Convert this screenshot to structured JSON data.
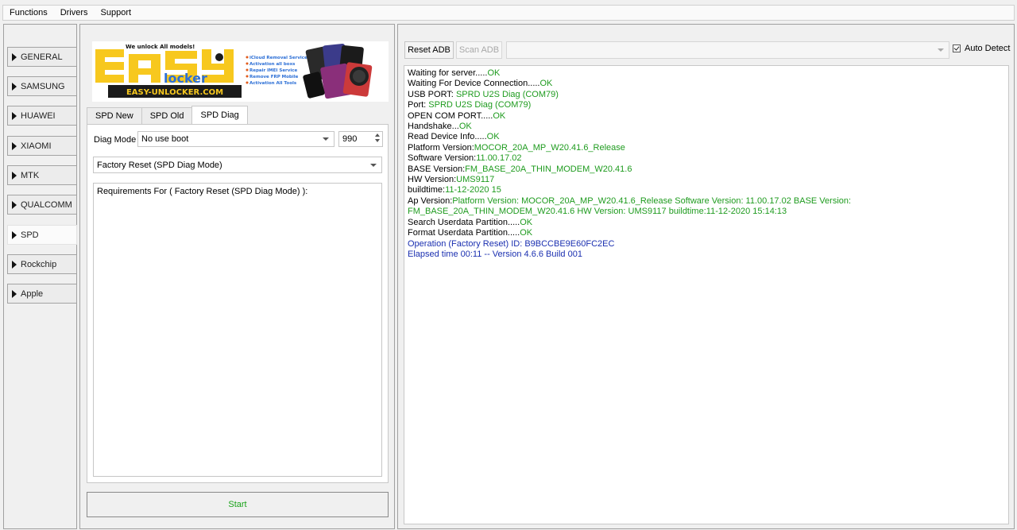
{
  "menu": [
    "Functions",
    "Drivers",
    "Support"
  ],
  "brands": [
    {
      "label": "GENERAL",
      "active": false
    },
    {
      "label": "SAMSUNG",
      "active": false
    },
    {
      "label": "HUAWEI",
      "active": false
    },
    {
      "label": "XIAOMI",
      "active": false
    },
    {
      "label": "MTK",
      "active": false
    },
    {
      "label": "QUALCOMM",
      "active": false
    },
    {
      "label": "SPD",
      "active": true
    },
    {
      "label": "Rockchip",
      "active": false
    },
    {
      "label": "Apple",
      "active": false
    }
  ],
  "banner": {
    "slogan": "We unlock All models!",
    "logo_text_1": "EASY",
    "logo_text_2": "locker",
    "website": "EASY-UNLOCKER.COM",
    "features": [
      "iCloud Removal Service",
      "Activation all boxs",
      "Repair IMEI Service",
      "Remove FRP Mobile",
      "Activation All Tools"
    ],
    "colors": {
      "yellow": "#f7c81e",
      "blue": "#2c6fd6",
      "dark": "#1b1b1b"
    }
  },
  "tabs": [
    {
      "label": "SPD New",
      "active": false
    },
    {
      "label": "SPD Old",
      "active": false
    },
    {
      "label": "SPD Diag",
      "active": true
    }
  ],
  "diag": {
    "label": "Diag Mode",
    "mode_value": "No use boot",
    "spin_value": "990",
    "operation_value": "Factory Reset (SPD Diag Mode)",
    "requirements_text": "Requirements For ( Factory Reset (SPD Diag Mode) ):"
  },
  "start_label": "Start",
  "right": {
    "reset_adb": "Reset ADB",
    "scan_adb": "Scan ADB",
    "device_value": "",
    "auto_detect": "Auto Detect",
    "auto_detect_checked": true
  },
  "log": [
    {
      "k": "Waiting for server.....",
      "v": "OK",
      "c": "ok"
    },
    {
      "k": "Waiting For Device Connection.....",
      "v": "OK",
      "c": "ok"
    },
    {
      "k": "USB PORT: ",
      "v": "SPRD U2S Diag (COM79)",
      "c": "ok"
    },
    {
      "k": "Port: ",
      "v": "SPRD U2S Diag (COM79)",
      "c": "ok"
    },
    {
      "k": "OPEN COM PORT.....",
      "v": "OK",
      "c": "ok"
    },
    {
      "k": "Handshake...",
      "v": "OK",
      "c": "ok"
    },
    {
      "k": "Read Device Info.....",
      "v": "OK",
      "c": "ok"
    },
    {
      "k": "Platform Version:",
      "v": "MOCOR_20A_MP_W20.41.6_Release",
      "c": "ok"
    },
    {
      "k": "Software Version:",
      "v": "11.00.17.02",
      "c": "ok"
    },
    {
      "k": "BASE Version:",
      "v": "FM_BASE_20A_THIN_MODEM_W20.41.6",
      "c": "ok"
    },
    {
      "k": "HW Version:",
      "v": "UMS9117",
      "c": "ok"
    },
    {
      "k": "buildtime:",
      "v": "11-12-2020 15",
      "c": "ok"
    },
    {
      "k": "Ap Version:",
      "v": "Platform Version: MOCOR_20A_MP_W20.41.6_Release Software Version: 11.00.17.02 BASE Version: FM_BASE_20A_THIN_MODEM_W20.41.6 HW Version: UMS9117 buildtime:11-12-2020 15:14:13",
      "c": "ok",
      "wrap": true
    },
    {
      "k": "Search Userdata Partition.....",
      "v": "OK",
      "c": "ok"
    },
    {
      "k": "Format Userdata Partition.....",
      "v": "OK",
      "c": "ok"
    },
    {
      "k": "",
      "v": "Operation (Factory Reset) ID: B9BCCBE9E60FC2EC",
      "c": "blue"
    },
    {
      "k": "",
      "v": "Elapsed time 00:11 -- Version 4.6.6 Build 001",
      "c": "blue"
    }
  ]
}
